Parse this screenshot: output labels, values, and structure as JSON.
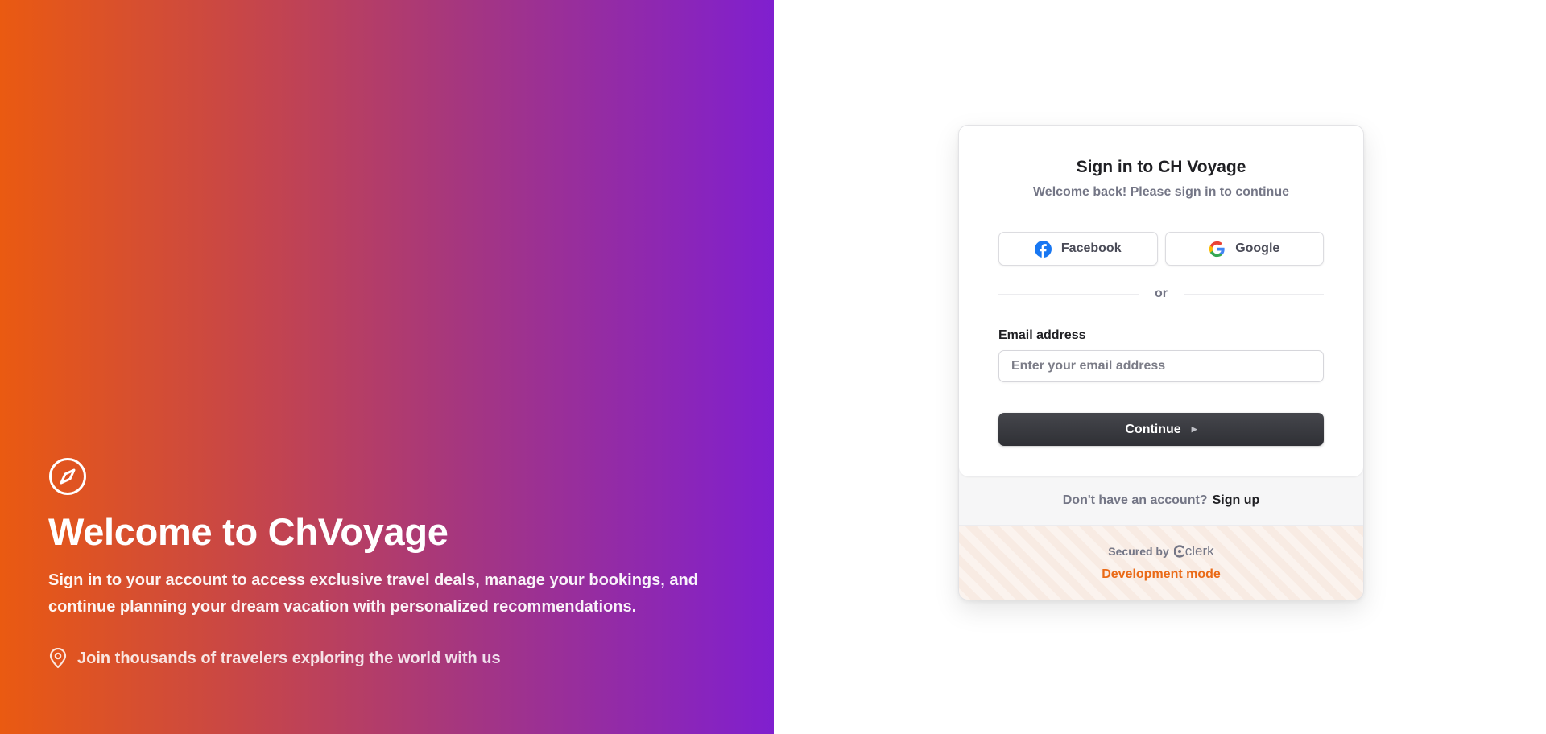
{
  "hero": {
    "icon": "compass-icon",
    "title": "Welcome to ChVoyage",
    "subtitle": "Sign in to your account to access exclusive travel deals, manage your bookings, and continue planning your dream vacation with personalized recommendations.",
    "note_icon": "map-pin-icon",
    "note": "Join thousands of travelers exploring the world with us",
    "gradient_start": "#ea5a11",
    "gradient_end": "#801fcf"
  },
  "signin": {
    "title": "Sign in to CH Voyage",
    "subtitle": "Welcome back! Please sign in to continue",
    "social": [
      {
        "label": "Facebook",
        "icon": "facebook-icon"
      },
      {
        "label": "Google",
        "icon": "google-icon"
      }
    ],
    "divider": "or",
    "email_label": "Email address",
    "email_placeholder": "Enter your email address",
    "email_value": "",
    "continue_label": "Continue",
    "continue_icon": "triangle-right-icon"
  },
  "footer": {
    "no_account": "Don't have an account?",
    "signup_label": "Sign up",
    "secured_by": "Secured by",
    "provider": "clerk",
    "dev_mode": "Development mode",
    "dev_mode_color": "#ea6a17"
  }
}
